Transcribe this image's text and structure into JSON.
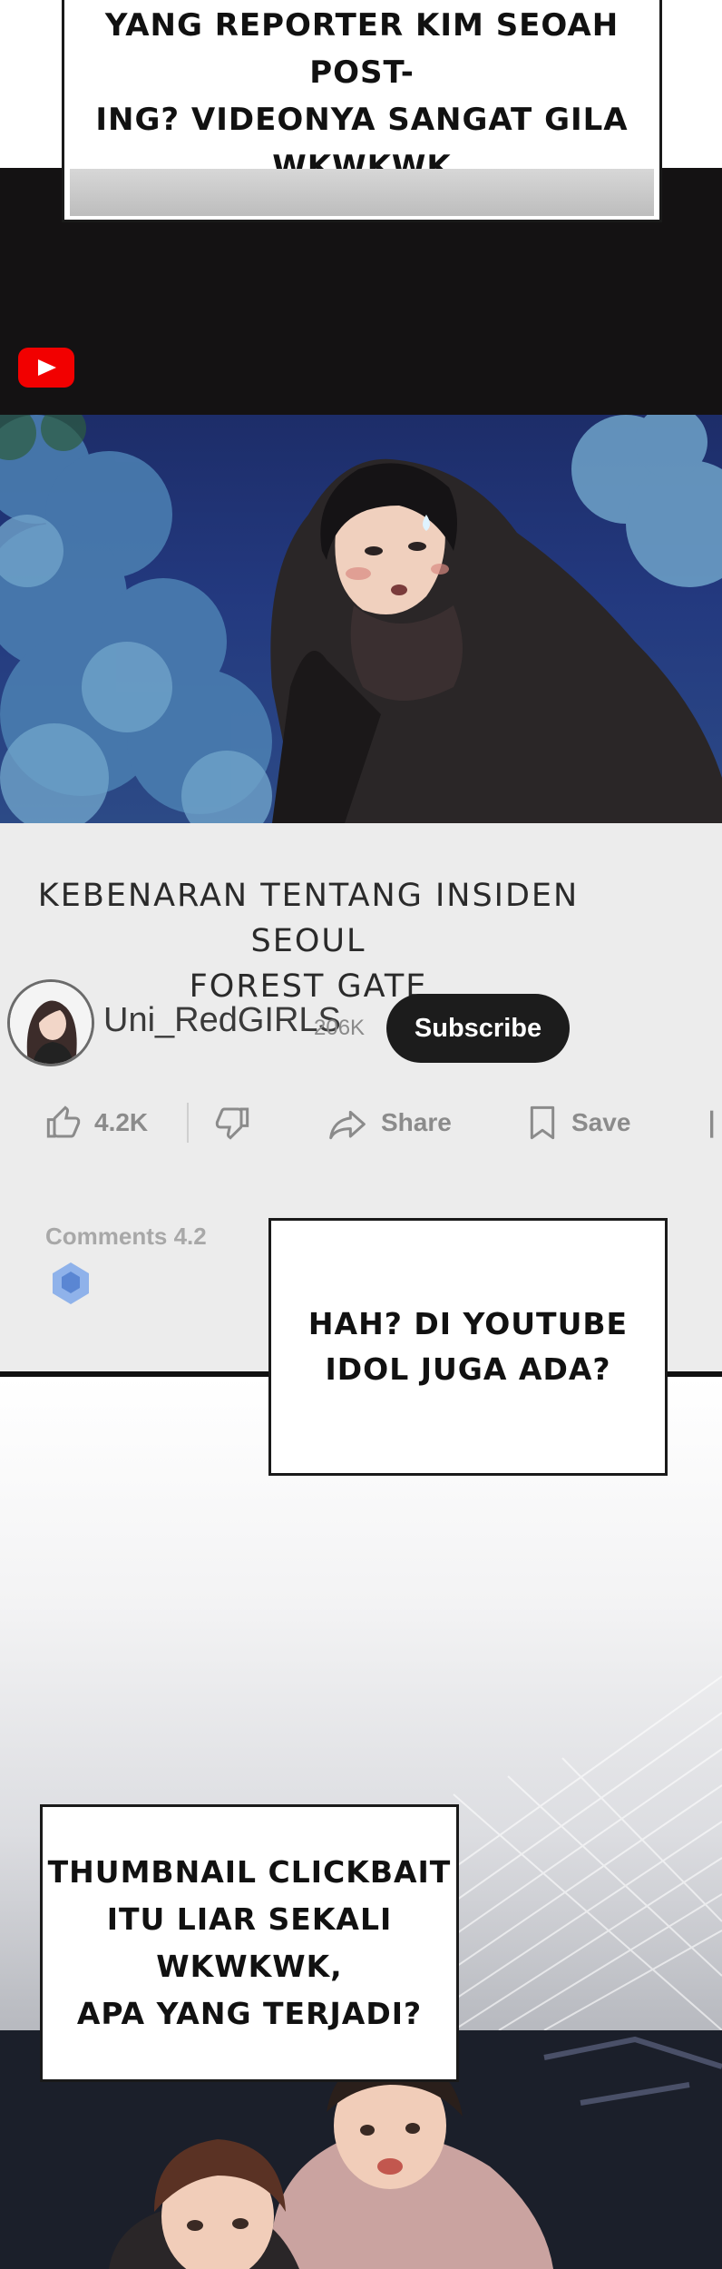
{
  "captions": {
    "top": "YANG REPORTER KIM SEOAH POST-\nING? VIDEONYA SANGAT GILA\nWKWKWK",
    "middle": "HAH? DI YOUTUBE\nIDOL JUGA ADA?",
    "bottom": "THUMBNAIL CLICKBAIT\nITU LIAR SEKALI WKWKWK,\nAPA YANG TERJADI?"
  },
  "video": {
    "title": "KEBENARAN TENTANG INSIDEN SEOUL\nFOREST GATE",
    "channel_name": "Uni_RedGIRLS",
    "subscriber_count": "206K",
    "subscribe_label": "Subscribe"
  },
  "actions": {
    "like_count": "4.2K",
    "share_label": "Share",
    "save_label": "Save"
  },
  "comments": {
    "label": "Comments 4.2"
  },
  "colors": {
    "youtube_red": "#f20000",
    "panel_bg": "#ececec",
    "subscribe_bg": "#1c1c1c",
    "night_sky": "#1d2d69"
  },
  "icons": [
    "youtube-logo-icon",
    "like-icon",
    "dislike-icon",
    "share-icon",
    "save-icon",
    "more-icon"
  ]
}
